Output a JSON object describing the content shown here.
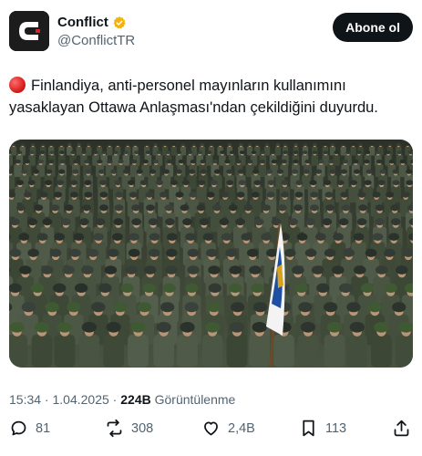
{
  "account": {
    "display_name": "Conflict",
    "handle": "@ConflictTR",
    "verified": true,
    "verified_color": "#f4b30a",
    "avatar_icon": "conflict-logo-icon"
  },
  "follow_button": {
    "label": "Abone ol"
  },
  "tweet": {
    "status_icon": "red-circle-icon",
    "text": "Finlandiya, anti-personel mayınların kullanımını yasaklayan Ottawa Anlaşması'ndan çekildiğini duyurdu."
  },
  "media": {
    "description_icon": "soldiers-photo"
  },
  "meta": {
    "time": "15:34",
    "separator": " · ",
    "date": "1.04.2025",
    "views_count": "224B",
    "views_label": " Görüntülenme"
  },
  "actions": {
    "replies": "81",
    "reposts": "308",
    "likes": "2,4B",
    "bookmarks": "113"
  },
  "colors": {
    "text_primary": "#0f1419",
    "text_secondary": "#536471",
    "button_bg": "#0f1419"
  }
}
